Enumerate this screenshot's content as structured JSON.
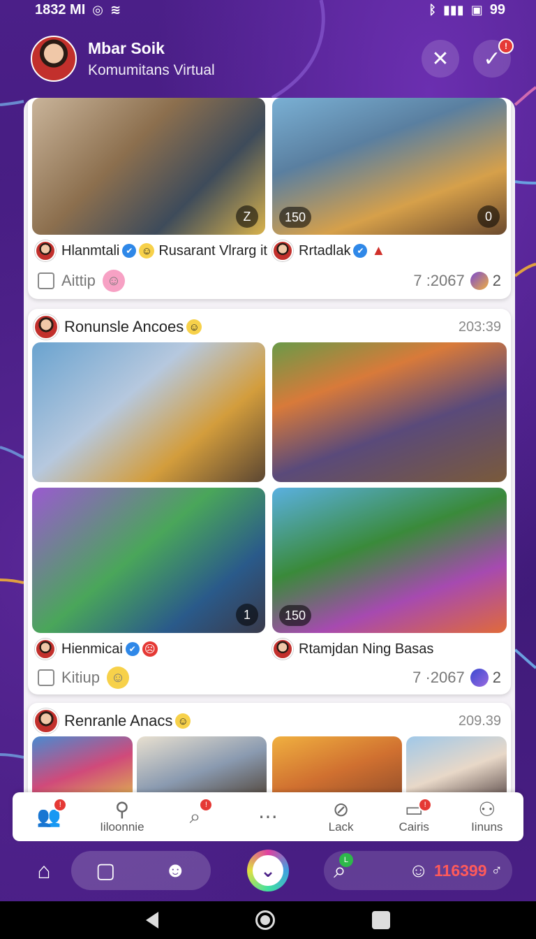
{
  "status": {
    "time": "1832 MI",
    "battery": "99"
  },
  "header": {
    "title": "Mbar Soik",
    "subtitle": "Komumitans Virtual"
  },
  "card1": {
    "photo_left_corner": "Z",
    "photo_right_count": "150",
    "photo_right_corner": "0",
    "user_left": "Hlanmtali",
    "user_mid": "Rusarant Vlrarg it",
    "user_right": "Rrtadlak",
    "action_label": "Aittip",
    "stats": "7 :2067",
    "reaction_count": "2"
  },
  "card2": {
    "author": "Ronunsle Ancoes",
    "time": "203:39",
    "photo_c_corner": "1",
    "photo_f_count": "150",
    "user_left": "Hienmicai",
    "user_right": "Rtamjdan Ning Basas",
    "action_label": "Kitiup",
    "stats": "7 ·2067",
    "reaction_count": "2"
  },
  "card3": {
    "author": "Renranle Anacs",
    "time": "209.39"
  },
  "tabs": [
    {
      "label": "",
      "icon": "people-icon",
      "badge": "!"
    },
    {
      "label": "Iiloonnie",
      "icon": "person-icon",
      "badge": ""
    },
    {
      "label": "",
      "icon": "search-icon",
      "badge": "!"
    },
    {
      "label": "",
      "icon": "more-icon",
      "badge": ""
    },
    {
      "label": "Lack",
      "icon": "leaf-icon",
      "badge": ""
    },
    {
      "label": "Cairis",
      "icon": "message-icon",
      "badge": "!"
    },
    {
      "label": "Iinuns",
      "icon": "profile-icon",
      "badge": ""
    }
  ],
  "dock": {
    "count": "116399",
    "search_badge": "L"
  },
  "colors": {
    "background": "#4a1f86",
    "accent": "#2f88e8",
    "badge": "#e53935"
  }
}
